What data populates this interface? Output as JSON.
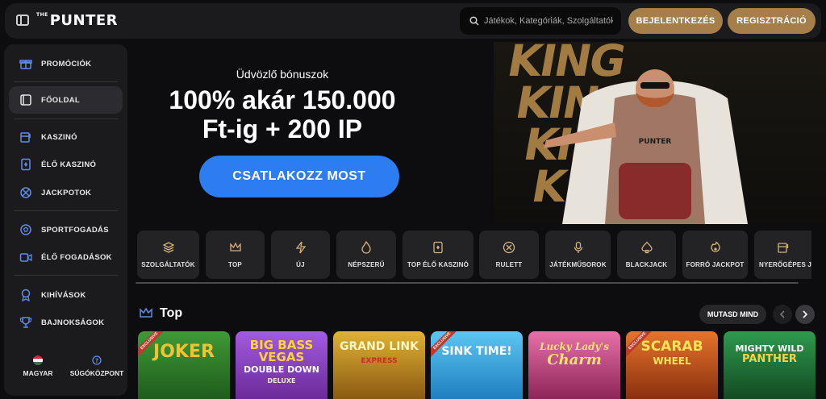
{
  "header": {
    "logo_prefix": "THE",
    "logo": "PUNTER",
    "search_placeholder": "Játékok, Kategóriák, Szolgáltatók",
    "login_label": "BEJELENTKEZÉS",
    "register_label": "REGISZTRÁCIÓ"
  },
  "sidebar": {
    "items": [
      {
        "label": "PROMÓCIÓK",
        "icon": "gift-icon"
      },
      {
        "label": "FŐOLDAL",
        "icon": "home-icon",
        "active": true
      },
      {
        "label": "KASZINÓ",
        "icon": "slot-machine-icon"
      },
      {
        "label": "ÉLŐ KASZINÓ",
        "icon": "card-icon"
      },
      {
        "label": "JACKPOTOK",
        "icon": "jackpot-icon"
      },
      {
        "label": "SPORTFOGADÁS",
        "icon": "ball-icon"
      },
      {
        "label": "ÉLŐ FOGADÁSOK",
        "icon": "live-video-icon"
      },
      {
        "label": "KIHÍVÁSOK",
        "icon": "badge-icon"
      },
      {
        "label": "BAJNOKSÁGOK",
        "icon": "trophy-icon"
      }
    ],
    "language_label": "MAGYAR",
    "help_label": "SÚGÓKÖZPONT"
  },
  "hero": {
    "subtitle": "Üdvözlő bónuszok",
    "title_line1": "100% akár 150.000",
    "title_line2": "Ft-ig + 200 IP",
    "cta_label": "CSATLAKOZZ MOST",
    "banner_word": "KING"
  },
  "categories": [
    {
      "label": "SZOLGÁLTATÓK",
      "icon": "layers-icon"
    },
    {
      "label": "TOP",
      "icon": "crown-icon"
    },
    {
      "label": "ÚJ",
      "icon": "lightning-icon"
    },
    {
      "label": "NÉPSZERŰ",
      "icon": "flame-icon"
    },
    {
      "label": "TOP ÉLŐ KASZINÓ",
      "icon": "live-card-icon"
    },
    {
      "label": "RULETT",
      "icon": "roulette-icon"
    },
    {
      "label": "JÁTÉKMŰSOROK",
      "icon": "microphone-icon"
    },
    {
      "label": "BLACKJACK",
      "icon": "spade-icon"
    },
    {
      "label": "FORRÓ JACKPOT",
      "icon": "hot-jackpot-icon"
    },
    {
      "label": "NYERŐGÉPES JÁ",
      "icon": "slot-icon"
    }
  ],
  "top_section": {
    "title": "Top",
    "show_all_label": "MUTASD MIND"
  },
  "games": [
    {
      "name": "JOKER",
      "bg": "#2f7a2c"
    },
    {
      "name": "BIG BASS VEGAS",
      "sub": "DOUBLE DOWN",
      "sub2": "DELUXE",
      "bg": "#8a3fb8"
    },
    {
      "name": "GRAND LINK",
      "sub": "EXPRESS",
      "bg": "#d9a520"
    },
    {
      "name": "SINK TIME!",
      "bg": "#3aa7e0"
    },
    {
      "name": "Lucky Lady's",
      "sub": "Charm",
      "bg": "#c2487d"
    },
    {
      "name": "SCARAB",
      "sub": "WHEEL",
      "bg": "#c7531f"
    },
    {
      "name": "MIGHTY WILD",
      "sub": "PANTHER",
      "bg": "#1e7a3a"
    }
  ],
  "colors": {
    "accent_gold": "#a57e4a",
    "cta_blue": "#2b7df1",
    "panel": "#1b1b1e"
  }
}
